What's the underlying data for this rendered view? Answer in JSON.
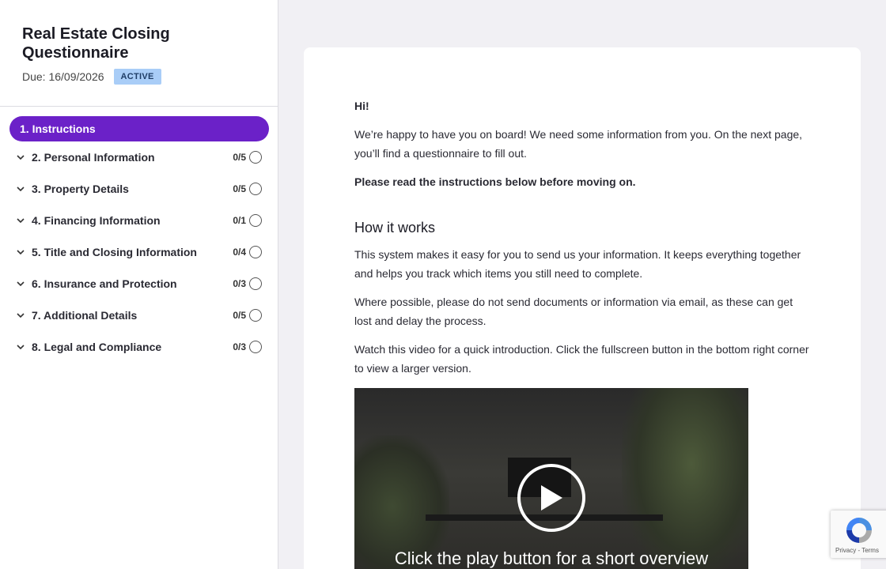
{
  "sidebar": {
    "title": "Real Estate Closing Questionnaire",
    "due": "Due: 16/09/2026",
    "status_badge": "ACTIVE",
    "active_item": "1. Instructions",
    "items": [
      {
        "label": "2. Personal Information",
        "count": "0/5"
      },
      {
        "label": "3. Property Details",
        "count": "0/5"
      },
      {
        "label": "4. Financing Information",
        "count": "0/1"
      },
      {
        "label": "5. Title and Closing Information",
        "count": "0/4"
      },
      {
        "label": "6. Insurance and Protection",
        "count": "0/3"
      },
      {
        "label": "7. Additional Details",
        "count": "0/5"
      },
      {
        "label": "8. Legal and Compliance",
        "count": "0/3"
      }
    ]
  },
  "content": {
    "greeting": "Hi!",
    "intro": "We’re happy to have you on board! We need some information from you. On the next page, you’ll find a questionnaire to fill out.",
    "instruction_note": "Please read the instructions below before moving on.",
    "heading": "How it works",
    "para1": "This system makes it easy for you to send us your information. It keeps everything together and helps you track which items you still need to complete.",
    "para2": "Where possible, please do not send documents or information via email, as these can get lost and delay the process.",
    "para3": "Watch this video for a quick introduction. Click the fullscreen button in the bottom right corner to view a larger version.",
    "video_caption": "Click the play button for a short overview"
  },
  "recaptcha": {
    "links": "Privacy - Terms"
  },
  "colors": {
    "accent": "#6b21c8",
    "badge_bg": "#a9cdf7",
    "page_bg": "#f1f0f4"
  },
  "icons": [
    "chevron-down-icon",
    "status-circle-icon",
    "play-icon",
    "recaptcha-icon"
  ]
}
